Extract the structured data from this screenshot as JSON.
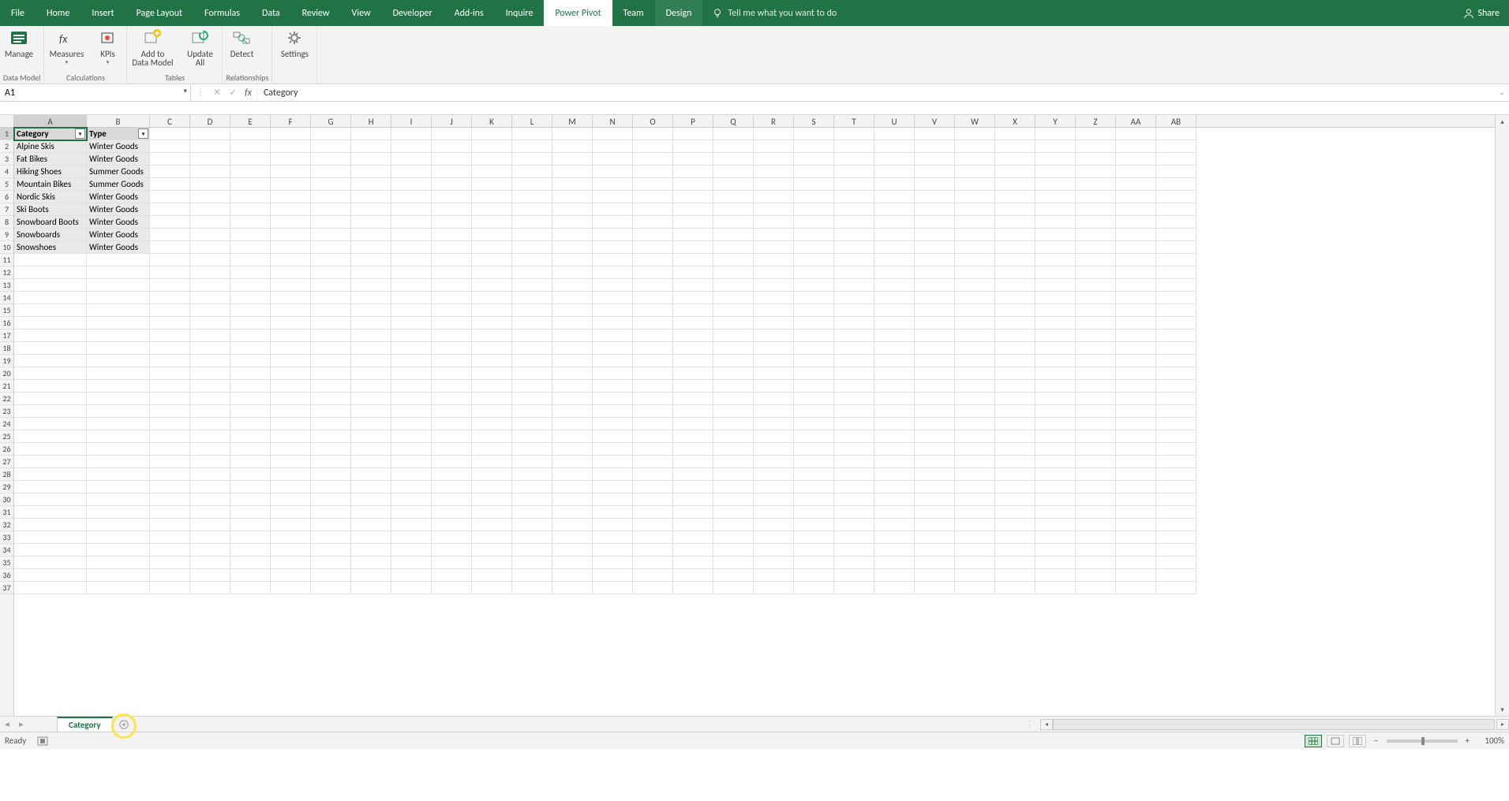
{
  "menus": [
    "File",
    "Home",
    "Insert",
    "Page Layout",
    "Formulas",
    "Data",
    "Review",
    "View",
    "Developer",
    "Add-ins",
    "Inquire",
    "Power Pivot",
    "Team",
    "Design"
  ],
  "active_menu": "Power Pivot",
  "tell_me": "Tell me what you want to do",
  "share": "Share",
  "ribbon": {
    "groups": [
      {
        "label": "Data Model",
        "buttons": [
          {
            "label": "Manage",
            "dd": false
          }
        ]
      },
      {
        "label": "Calculations",
        "buttons": [
          {
            "label": "Measures",
            "dd": true
          },
          {
            "label": "KPIs",
            "dd": true
          }
        ]
      },
      {
        "label": "Tables",
        "buttons": [
          {
            "label": "Add to\nData Model",
            "dd": false
          },
          {
            "label": "Update\nAll",
            "dd": false
          }
        ]
      },
      {
        "label": "Relationships",
        "buttons": [
          {
            "label": "Detect",
            "dd": false
          }
        ]
      },
      {
        "label": "",
        "buttons": [
          {
            "label": "Settings",
            "dd": false
          }
        ]
      }
    ]
  },
  "namebox": "A1",
  "formula": "Category",
  "columns": [
    "A",
    "B",
    "C",
    "D",
    "E",
    "F",
    "G",
    "H",
    "I",
    "J",
    "K",
    "L",
    "M",
    "N",
    "O",
    "P",
    "Q",
    "R",
    "S",
    "T",
    "U",
    "V",
    "W",
    "X",
    "Y",
    "Z",
    "AA",
    "AB"
  ],
  "col_widths": {
    "A": 92,
    "B": 80,
    "default": 51
  },
  "row_count": 37,
  "selected_cell": {
    "row": 1,
    "col": "A"
  },
  "table": {
    "headers": [
      "Category",
      "Type"
    ],
    "rows": [
      [
        "Alpine Skis",
        "Winter Goods"
      ],
      [
        "Fat Bikes",
        "Winter Goods"
      ],
      [
        "Hiking Shoes",
        "Summer Goods"
      ],
      [
        "Mountain Bikes",
        "Summer Goods"
      ],
      [
        "Nordic Skis",
        "Winter Goods"
      ],
      [
        "Ski Boots",
        "Winter Goods"
      ],
      [
        "Snowboard Boots",
        "Winter Goods"
      ],
      [
        "Snowboards",
        "Winter Goods"
      ],
      [
        "Snowshoes",
        "Winter Goods"
      ]
    ]
  },
  "sheet_tab": "Category",
  "status": {
    "ready": "Ready",
    "zoom": "100%"
  }
}
